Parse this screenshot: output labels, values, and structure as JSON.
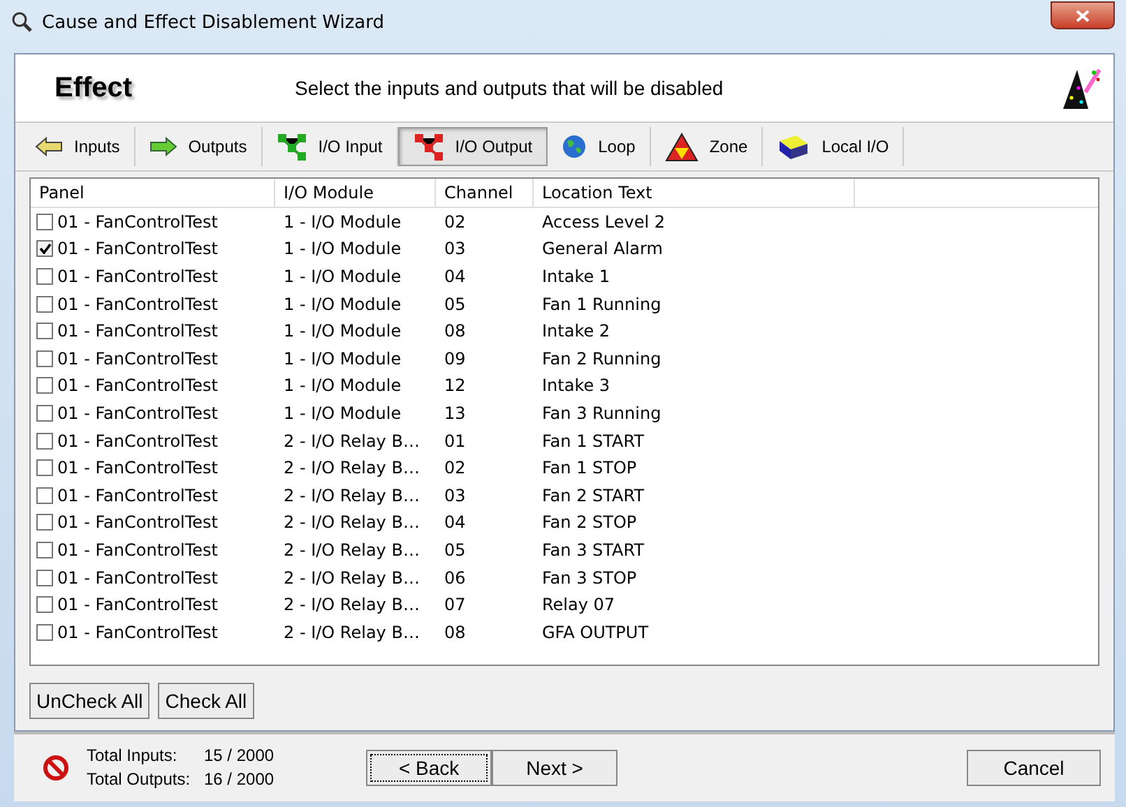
{
  "window": {
    "title": "Cause and Effect Disablement Wizard"
  },
  "header": {
    "title": "Effect",
    "instruction": "Select the inputs and outputs that will be disabled"
  },
  "tabs": [
    {
      "label": "Inputs",
      "kind": "arrow-left",
      "selected": false
    },
    {
      "label": "Outputs",
      "kind": "arrow-right",
      "selected": false
    },
    {
      "label": "I/O Input",
      "kind": "io-input",
      "selected": false
    },
    {
      "label": "I/O Output",
      "kind": "io-output",
      "selected": true
    },
    {
      "label": "Loop",
      "kind": "globe",
      "selected": false
    },
    {
      "label": "Zone",
      "kind": "triangle",
      "selected": false
    },
    {
      "label": "Local I/O",
      "kind": "module",
      "selected": false
    }
  ],
  "table": {
    "columns": [
      "Panel",
      "I/O Module",
      "Channel",
      "Location Text"
    ],
    "rows": [
      {
        "checked": false,
        "panel": "01 - FanControlTest",
        "module": "1 - I/O Module",
        "channel": "02",
        "location": "Access Level 2"
      },
      {
        "checked": true,
        "panel": "01 - FanControlTest",
        "module": "1 - I/O Module",
        "channel": "03",
        "location": "General Alarm"
      },
      {
        "checked": false,
        "panel": "01 - FanControlTest",
        "module": "1 - I/O Module",
        "channel": "04",
        "location": "Intake 1"
      },
      {
        "checked": false,
        "panel": "01 - FanControlTest",
        "module": "1 - I/O Module",
        "channel": "05",
        "location": "Fan 1 Running"
      },
      {
        "checked": false,
        "panel": "01 - FanControlTest",
        "module": "1 - I/O Module",
        "channel": "08",
        "location": "Intake 2"
      },
      {
        "checked": false,
        "panel": "01 - FanControlTest",
        "module": "1 - I/O Module",
        "channel": "09",
        "location": "Fan 2 Running"
      },
      {
        "checked": false,
        "panel": "01 - FanControlTest",
        "module": "1 - I/O Module",
        "channel": "12",
        "location": "Intake 3"
      },
      {
        "checked": false,
        "panel": "01 - FanControlTest",
        "module": "1 - I/O Module",
        "channel": "13",
        "location": "Fan 3 Running"
      },
      {
        "checked": false,
        "panel": "01 - FanControlTest",
        "module": "2 - I/O Relay B…",
        "channel": "01",
        "location": "Fan 1 START"
      },
      {
        "checked": false,
        "panel": "01 - FanControlTest",
        "module": "2 - I/O Relay B…",
        "channel": "02",
        "location": "Fan 1 STOP"
      },
      {
        "checked": false,
        "panel": "01 - FanControlTest",
        "module": "2 - I/O Relay B…",
        "channel": "03",
        "location": "Fan 2 START"
      },
      {
        "checked": false,
        "panel": "01 - FanControlTest",
        "module": "2 - I/O Relay B…",
        "channel": "04",
        "location": "Fan 2 STOP"
      },
      {
        "checked": false,
        "panel": "01 - FanControlTest",
        "module": "2 - I/O Relay B…",
        "channel": "05",
        "location": "Fan 3 START"
      },
      {
        "checked": false,
        "panel": "01 - FanControlTest",
        "module": "2 - I/O Relay B…",
        "channel": "06",
        "location": "Fan 3 STOP"
      },
      {
        "checked": false,
        "panel": "01 - FanControlTest",
        "module": "2 - I/O Relay B…",
        "channel": "07",
        "location": "Relay 07"
      },
      {
        "checked": false,
        "panel": "01 - FanControlTest",
        "module": "2 - I/O Relay B…",
        "channel": "08",
        "location": "GFA OUTPUT"
      }
    ]
  },
  "list_buttons": [
    "UnCheck All",
    "Check All"
  ],
  "totals": [
    {
      "label": "Total Inputs:",
      "value": "15 / 2000"
    },
    {
      "label": "Total Outputs:",
      "value": "16 / 2000"
    }
  ],
  "nav_buttons": [
    "< Back",
    "Next >",
    "Cancel"
  ]
}
